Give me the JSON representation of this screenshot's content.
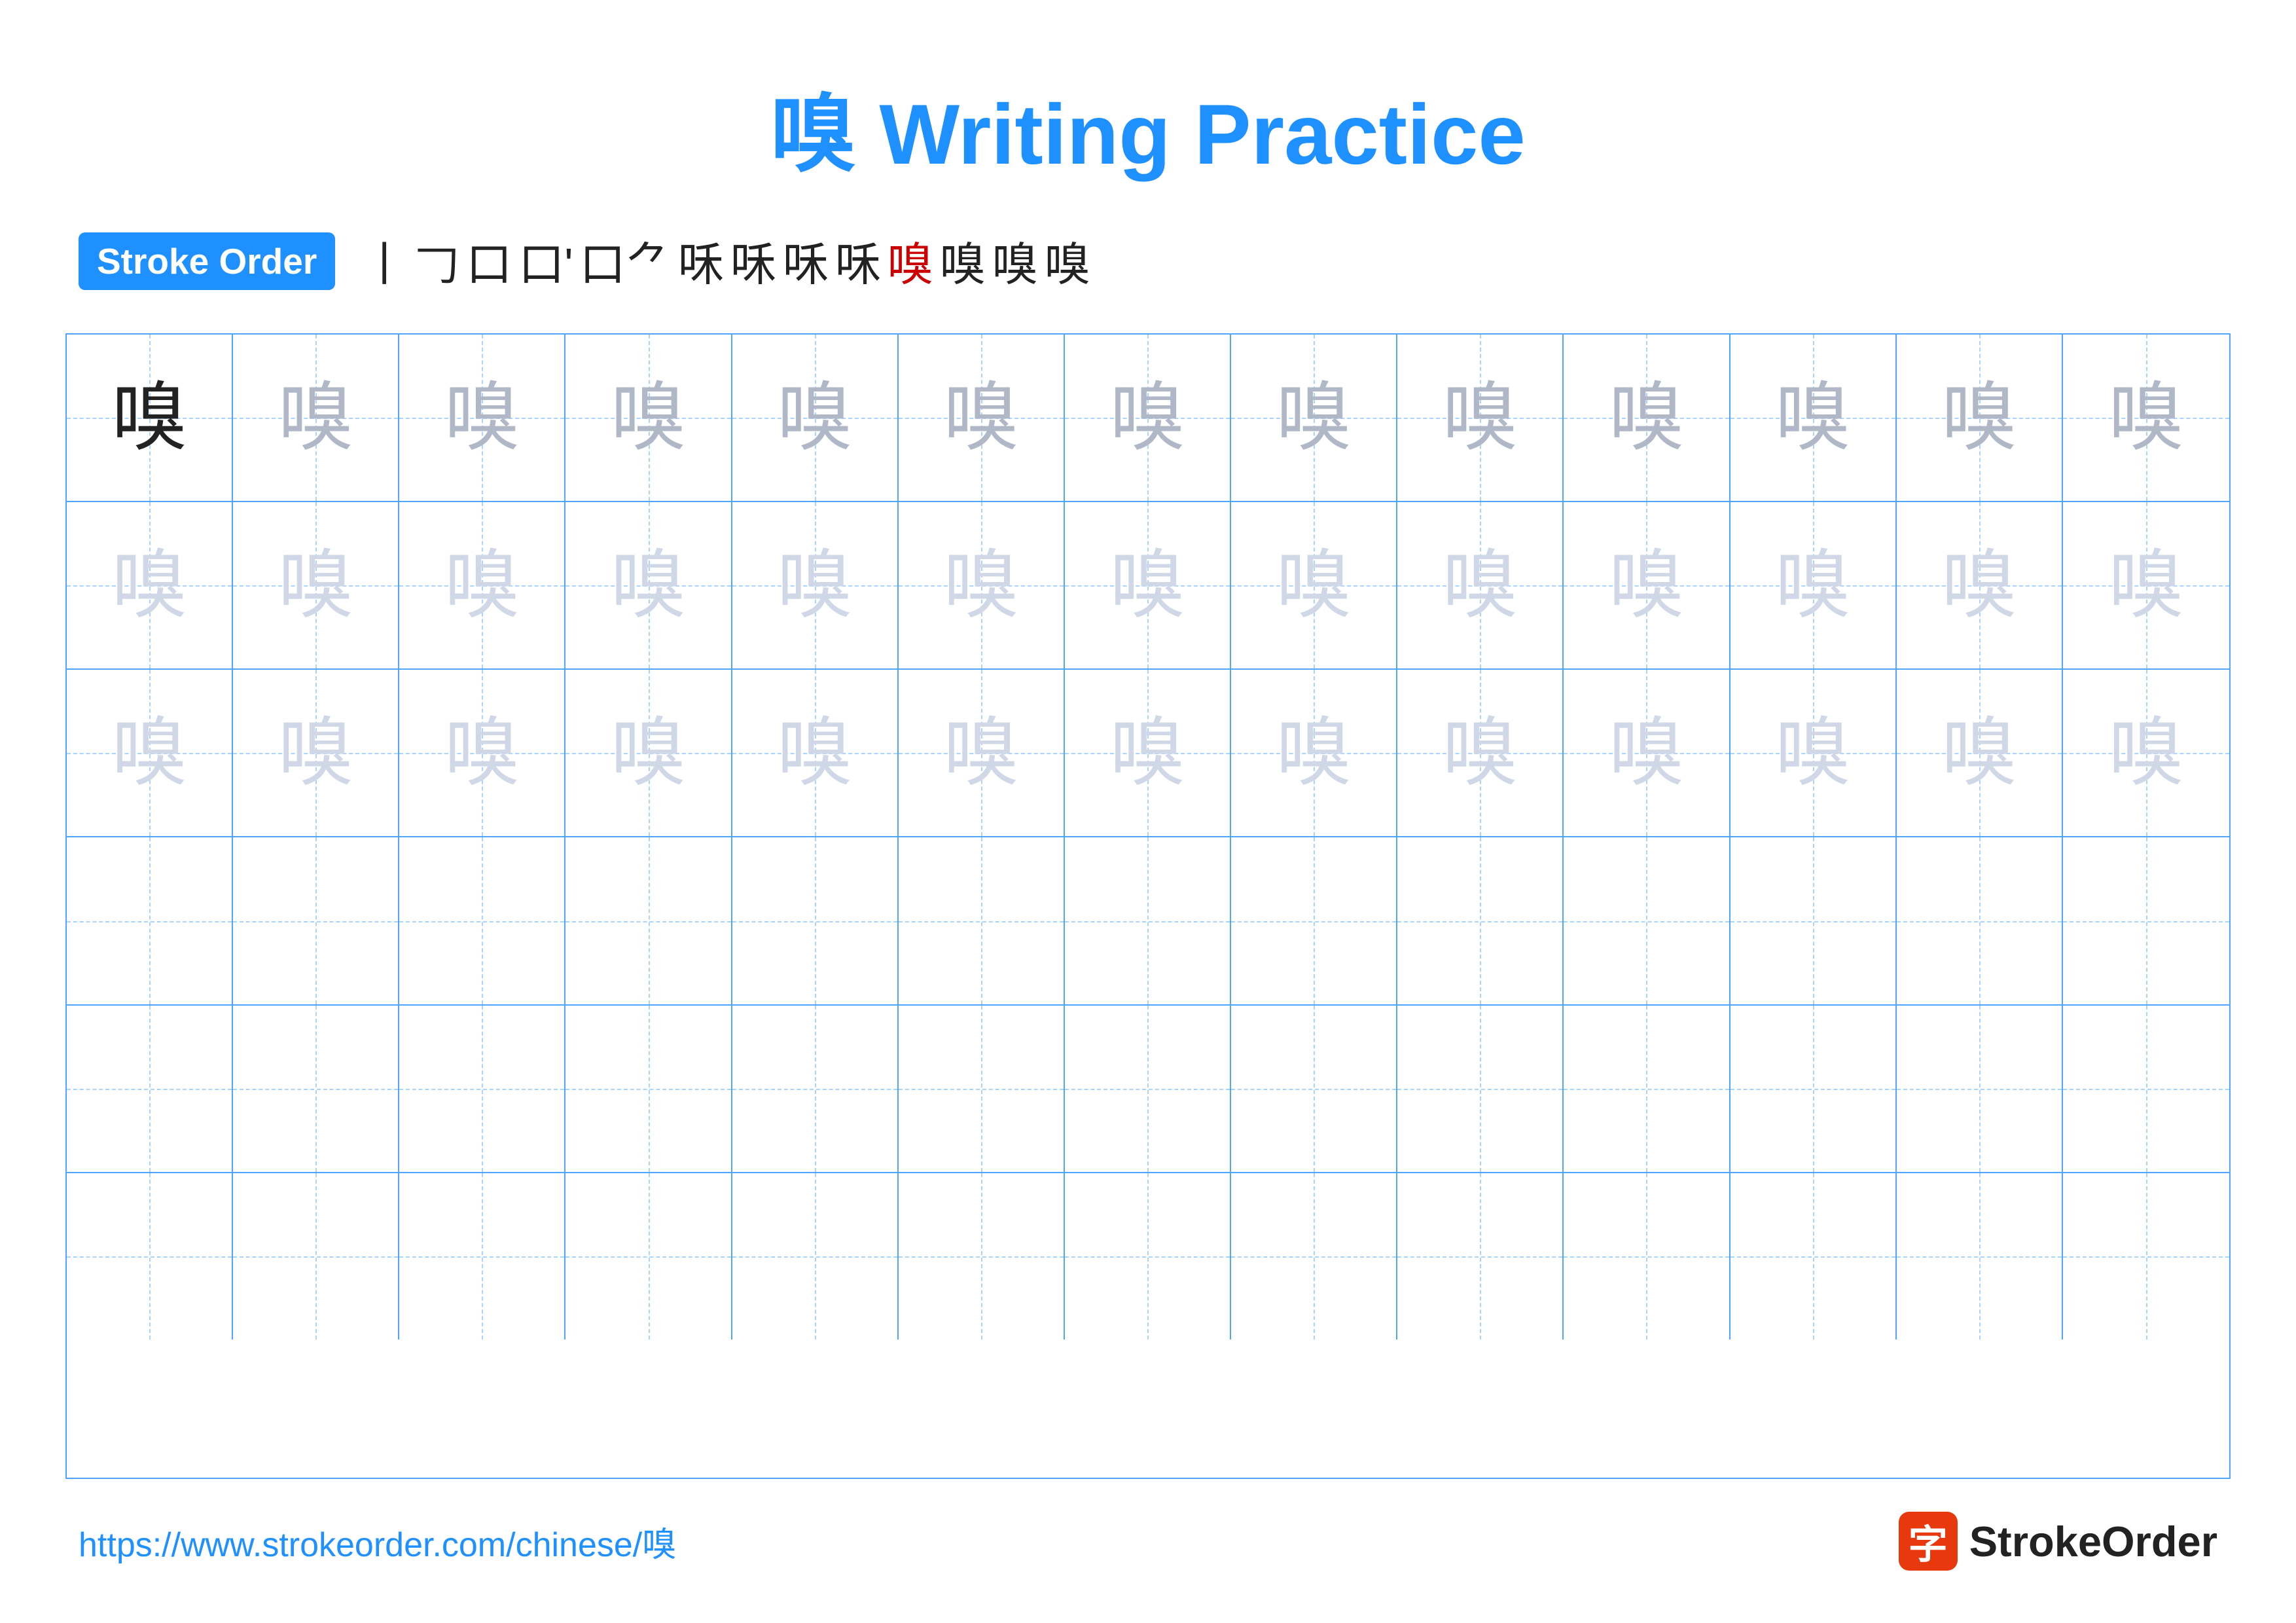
{
  "title": "嗅 Writing Practice",
  "stroke_order_badge": "Stroke Order",
  "stroke_sequence": [
    "丨",
    "𠃌",
    "口",
    "口丶",
    "口乚",
    "嗅㇀",
    "嗅㇀",
    "嗅㇀",
    "嗅㇀",
    "嗅㇀",
    "嗅",
    "嗅",
    "嗅"
  ],
  "character": "嗅",
  "footer_url": "https://www.strokeorder.com/chinese/嗅",
  "footer_logo_text": "StrokeOrder",
  "rows": [
    {
      "cells": [
        {
          "char": "嗅",
          "style": "dark"
        },
        {
          "char": "嗅",
          "style": "medium"
        },
        {
          "char": "嗅",
          "style": "medium"
        },
        {
          "char": "嗅",
          "style": "medium"
        },
        {
          "char": "嗅",
          "style": "medium"
        },
        {
          "char": "嗅",
          "style": "medium"
        },
        {
          "char": "嗅",
          "style": "medium"
        },
        {
          "char": "嗅",
          "style": "medium"
        },
        {
          "char": "嗅",
          "style": "medium"
        },
        {
          "char": "嗅",
          "style": "medium"
        },
        {
          "char": "嗅",
          "style": "medium"
        },
        {
          "char": "嗅",
          "style": "medium"
        },
        {
          "char": "嗅",
          "style": "medium"
        }
      ]
    },
    {
      "cells": [
        {
          "char": "嗅",
          "style": "light"
        },
        {
          "char": "嗅",
          "style": "light"
        },
        {
          "char": "嗅",
          "style": "light"
        },
        {
          "char": "嗅",
          "style": "light"
        },
        {
          "char": "嗅",
          "style": "light"
        },
        {
          "char": "嗅",
          "style": "light"
        },
        {
          "char": "嗅",
          "style": "light"
        },
        {
          "char": "嗅",
          "style": "light"
        },
        {
          "char": "嗅",
          "style": "light"
        },
        {
          "char": "嗅",
          "style": "light"
        },
        {
          "char": "嗅",
          "style": "light"
        },
        {
          "char": "嗅",
          "style": "light"
        },
        {
          "char": "嗅",
          "style": "light"
        }
      ]
    },
    {
      "cells": [
        {
          "char": "嗅",
          "style": "light"
        },
        {
          "char": "嗅",
          "style": "light"
        },
        {
          "char": "嗅",
          "style": "light"
        },
        {
          "char": "嗅",
          "style": "light"
        },
        {
          "char": "嗅",
          "style": "light"
        },
        {
          "char": "嗅",
          "style": "light"
        },
        {
          "char": "嗅",
          "style": "light"
        },
        {
          "char": "嗅",
          "style": "light"
        },
        {
          "char": "嗅",
          "style": "light"
        },
        {
          "char": "嗅",
          "style": "light"
        },
        {
          "char": "嗅",
          "style": "light"
        },
        {
          "char": "嗅",
          "style": "light"
        },
        {
          "char": "嗅",
          "style": "light"
        }
      ]
    },
    {
      "cells": [
        {
          "char": "",
          "style": "empty"
        },
        {
          "char": "",
          "style": "empty"
        },
        {
          "char": "",
          "style": "empty"
        },
        {
          "char": "",
          "style": "empty"
        },
        {
          "char": "",
          "style": "empty"
        },
        {
          "char": "",
          "style": "empty"
        },
        {
          "char": "",
          "style": "empty"
        },
        {
          "char": "",
          "style": "empty"
        },
        {
          "char": "",
          "style": "empty"
        },
        {
          "char": "",
          "style": "empty"
        },
        {
          "char": "",
          "style": "empty"
        },
        {
          "char": "",
          "style": "empty"
        },
        {
          "char": "",
          "style": "empty"
        }
      ]
    },
    {
      "cells": [
        {
          "char": "",
          "style": "empty"
        },
        {
          "char": "",
          "style": "empty"
        },
        {
          "char": "",
          "style": "empty"
        },
        {
          "char": "",
          "style": "empty"
        },
        {
          "char": "",
          "style": "empty"
        },
        {
          "char": "",
          "style": "empty"
        },
        {
          "char": "",
          "style": "empty"
        },
        {
          "char": "",
          "style": "empty"
        },
        {
          "char": "",
          "style": "empty"
        },
        {
          "char": "",
          "style": "empty"
        },
        {
          "char": "",
          "style": "empty"
        },
        {
          "char": "",
          "style": "empty"
        },
        {
          "char": "",
          "style": "empty"
        }
      ]
    },
    {
      "cells": [
        {
          "char": "",
          "style": "empty"
        },
        {
          "char": "",
          "style": "empty"
        },
        {
          "char": "",
          "style": "empty"
        },
        {
          "char": "",
          "style": "empty"
        },
        {
          "char": "",
          "style": "empty"
        },
        {
          "char": "",
          "style": "empty"
        },
        {
          "char": "",
          "style": "empty"
        },
        {
          "char": "",
          "style": "empty"
        },
        {
          "char": "",
          "style": "empty"
        },
        {
          "char": "",
          "style": "empty"
        },
        {
          "char": "",
          "style": "empty"
        },
        {
          "char": "",
          "style": "empty"
        },
        {
          "char": "",
          "style": "empty"
        }
      ]
    }
  ]
}
